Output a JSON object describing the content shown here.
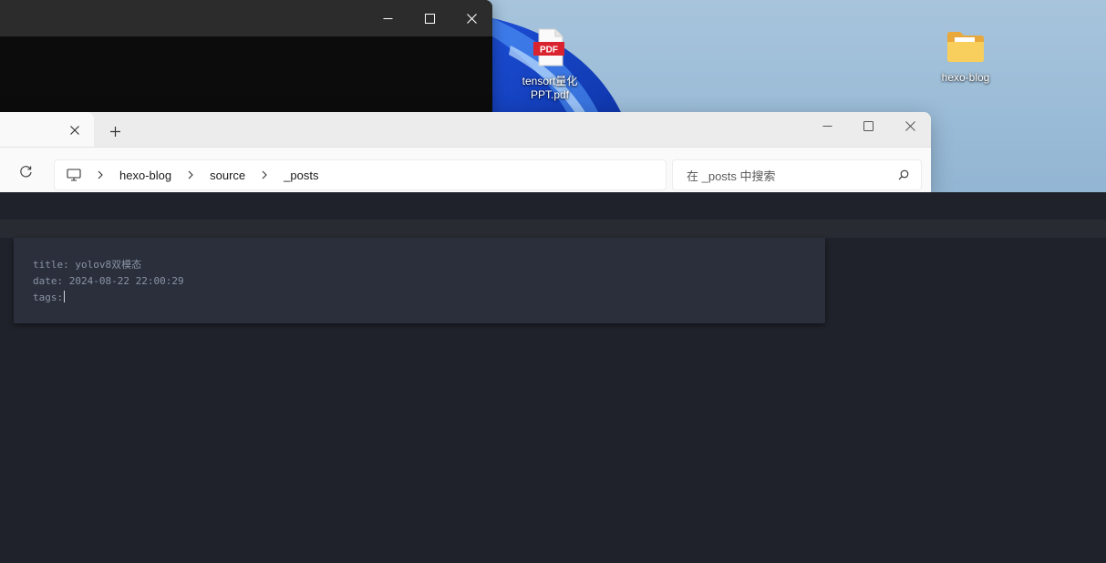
{
  "desktop": {
    "icons": [
      {
        "label_line1": "tensort量化",
        "label_line2": "PPT.pdf",
        "badge": "PDF",
        "icon": "pdf-file-icon"
      },
      {
        "label_line1": "hexo-blog",
        "label_line2": "",
        "icon": "folder-icon"
      }
    ]
  },
  "terminal": {
    "minimize": "minimize-icon",
    "maximize": "maximize-icon",
    "close": "close-icon"
  },
  "explorer": {
    "tab": {
      "close_icon": "close-icon"
    },
    "new_tab_icon": "plus-icon",
    "breadcrumb": [
      "hexo-blog",
      "source",
      "_posts"
    ],
    "search_placeholder": "在 _posts 中搜索"
  },
  "editor": {
    "lines": [
      "title: yolov8双模态",
      "date: 2024-08-22 22:00:29",
      "tags:"
    ]
  },
  "colors": {
    "editor_bg": "#1f222a",
    "panel_bg": "#2b2f3b",
    "code_text": "#8a93a6",
    "pdf_badge": "#d9232e",
    "folder": "#f7c948"
  }
}
